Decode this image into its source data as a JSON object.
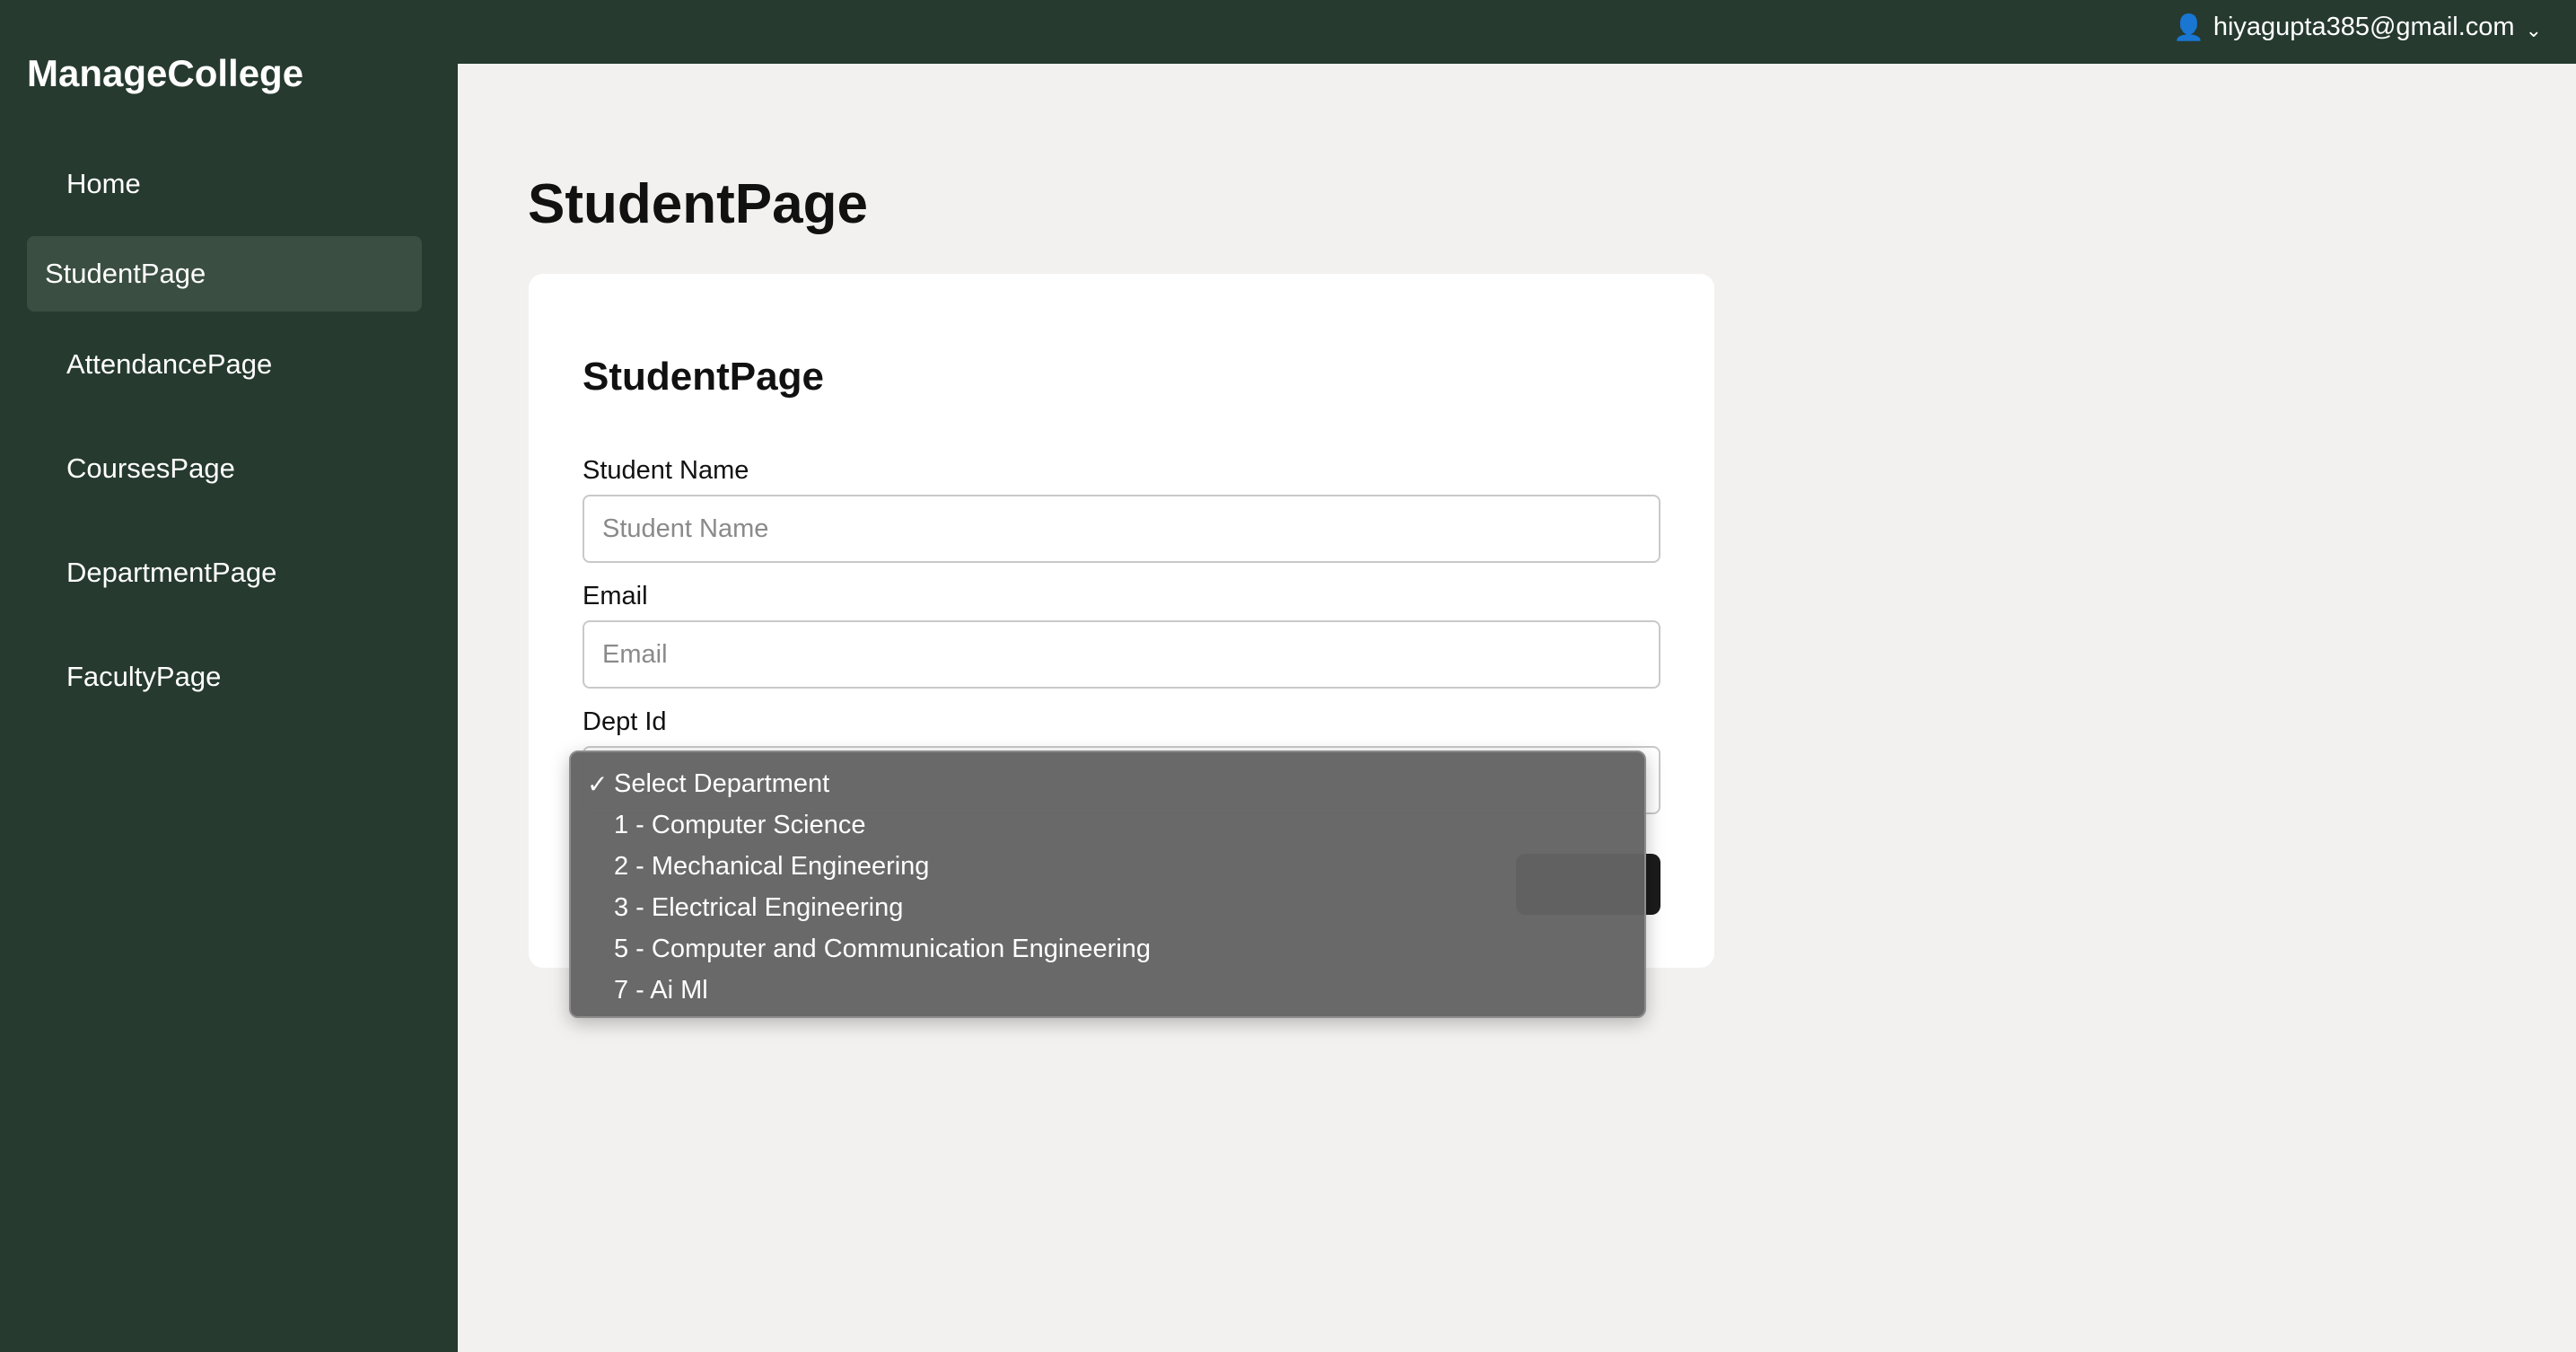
{
  "header": {
    "user_icon": "user-icon",
    "user_email": "hiyagupta385@gmail.com",
    "chevron": "⌄"
  },
  "sidebar": {
    "brand": "ManageCollege",
    "items": [
      {
        "label": "Home",
        "active": false
      },
      {
        "label": "StudentPage",
        "active": true
      },
      {
        "label": "AttendancePage",
        "active": false
      },
      {
        "label": "CoursesPage",
        "active": false
      },
      {
        "label": "DepartmentPage",
        "active": false
      },
      {
        "label": "FacultyPage",
        "active": false
      }
    ]
  },
  "main": {
    "title": "StudentPage",
    "card": {
      "title": "StudentPage",
      "student_name": {
        "label": "Student Name",
        "placeholder": "Student Name",
        "value": ""
      },
      "email": {
        "label": "Email",
        "placeholder": "Email",
        "value": ""
      },
      "dept": {
        "label": "Dept Id",
        "selected": "Select Department",
        "check_glyph": "✓",
        "options": [
          "Select Department",
          "1 - Computer Science",
          "2 - Mechanical Engineering",
          "3 - Electrical Engineering",
          "5 - Computer and Communication Engineering",
          "7 - Ai Ml"
        ]
      }
    }
  },
  "colors": {
    "sidebar_bg": "#263a2f",
    "active_item_bg": "#3a4e42",
    "page_bg": "#f2f1ef",
    "dropdown_bg": "#646464"
  }
}
